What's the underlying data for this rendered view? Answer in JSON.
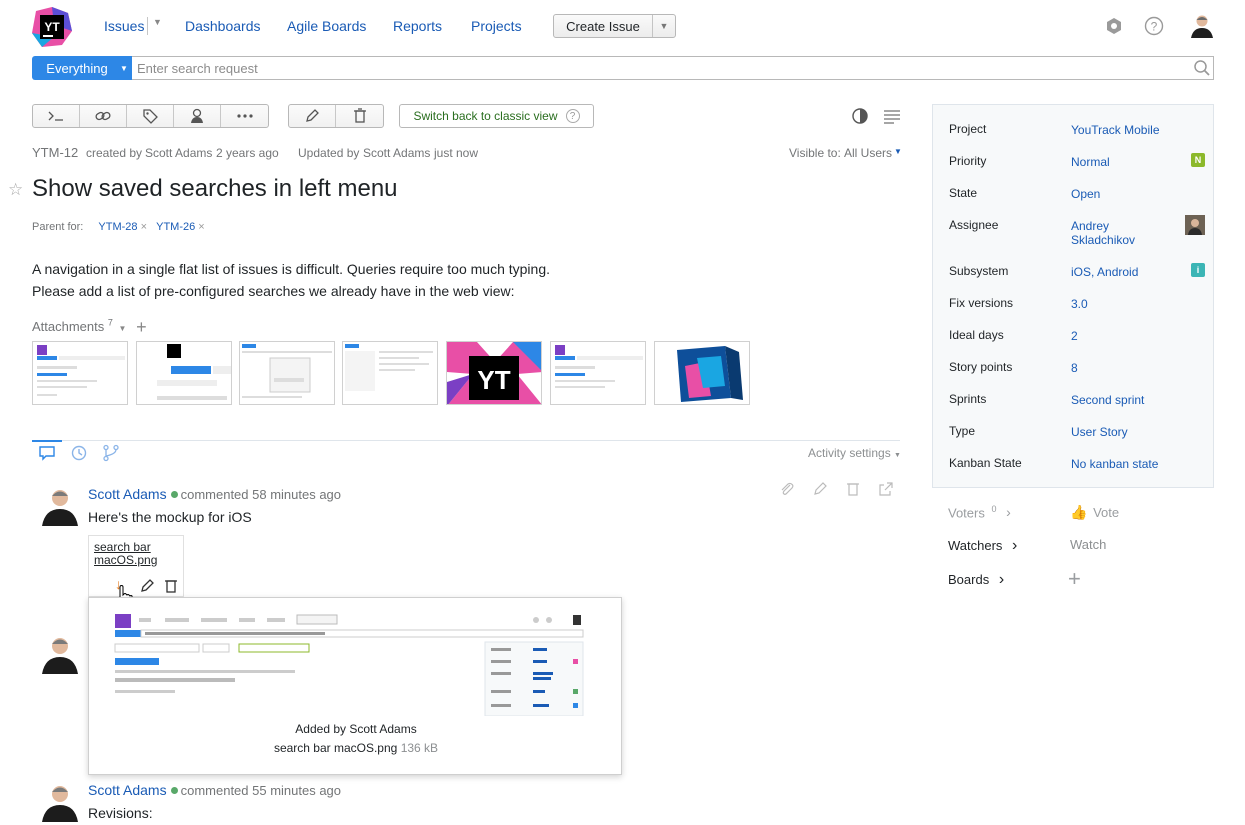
{
  "header": {
    "logo_text": "YT",
    "nav": [
      "Issues",
      "Dashboards",
      "Agile Boards",
      "Reports",
      "Projects"
    ],
    "create_issue": "Create Issue"
  },
  "search": {
    "context": "Everything",
    "placeholder": "Enter search request"
  },
  "toolbar": {
    "classic_view": "Switch back to classic view"
  },
  "issue": {
    "id": "YTM-12",
    "created_prefix": "created by",
    "created_by": "Scott Adams",
    "created_ago": "2 years ago",
    "updated_prefix": "Updated by",
    "updated_by": "Scott Adams",
    "updated_ago": "just now",
    "visible_label": "Visible to:",
    "visible_value": "All Users",
    "title": "Show saved searches in left menu",
    "parent_label": "Parent for:",
    "parents": [
      "YTM-28",
      "YTM-26"
    ],
    "description": [
      "A navigation in a single flat list of issues is difficult. Queries require too much typing.",
      "Please add a list of pre-configured searches we already have in the web view:"
    ],
    "attachments_label": "Attachments",
    "attachments_count": "7"
  },
  "activity": {
    "settings": "Activity settings"
  },
  "comments": [
    {
      "author": "Scott Adams",
      "action": "commented 58 minutes ago",
      "text": "Here's the mockup for iOS",
      "attachment_name": "search bar macOS.png"
    },
    {
      "author": "Scott Adams",
      "action": "commented 55 minutes ago",
      "text": "Revisions:"
    }
  ],
  "attachment_popup": {
    "added_by": "Added by Scott Adams",
    "filename": "search bar macOS.png",
    "size": "136 kB"
  },
  "fields": [
    {
      "label": "Project",
      "value": "YouTrack Mobile"
    },
    {
      "label": "Priority",
      "value": "Normal",
      "badge": "N",
      "badge_color": "#8cb92b"
    },
    {
      "label": "State",
      "value": "Open"
    },
    {
      "label": "Assignee",
      "value": "Andrey Skladchikov"
    },
    {
      "label": "Subsystem",
      "value": "iOS, Android",
      "badge": "i",
      "badge_color": "#3bb5b5"
    },
    {
      "label": "Fix versions",
      "value": "3.0"
    },
    {
      "label": "Ideal days",
      "value": "2"
    },
    {
      "label": "Story points",
      "value": "8"
    },
    {
      "label": "Sprints",
      "value": "Second sprint"
    },
    {
      "label": "Type",
      "value": "User Story"
    },
    {
      "label": "Kanban State",
      "value": "No kanban state"
    }
  ],
  "side": {
    "voters": "Voters",
    "voters_count": "0",
    "vote": "Vote",
    "watchers": "Watchers",
    "watch": "Watch",
    "boards": "Boards"
  },
  "colors": {
    "link": "#1a5bb5",
    "accent": "#2d87e6",
    "online": "#59a869"
  }
}
